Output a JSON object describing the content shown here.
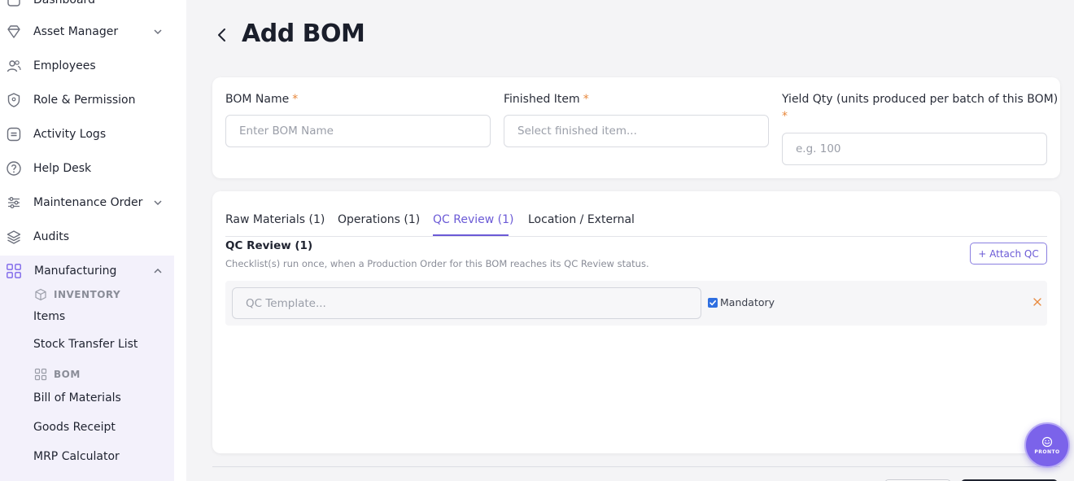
{
  "sidebar": {
    "items": [
      {
        "label": "Dashboard"
      },
      {
        "label": "Asset Manager"
      },
      {
        "label": "Employees"
      },
      {
        "label": "Role & Permission"
      },
      {
        "label": "Activity Logs"
      },
      {
        "label": "Help Desk"
      },
      {
        "label": "Maintenance Order"
      },
      {
        "label": "Audits"
      },
      {
        "label": "Manufacturing"
      }
    ],
    "manufacturing": {
      "inventory_group": "INVENTORY",
      "inventory_items": [
        {
          "label": "Items"
        },
        {
          "label": "Stock Transfer List"
        }
      ],
      "bom_group": "BOM",
      "bom_items": [
        {
          "label": "Bill of Materials"
        },
        {
          "label": "Goods Receipt"
        },
        {
          "label": "MRP Calculator"
        }
      ]
    }
  },
  "header": {
    "title": "Add BOM"
  },
  "form": {
    "bom_name": {
      "label": "BOM Name",
      "required": "*",
      "placeholder": "Enter BOM Name"
    },
    "finished_item": {
      "label": "Finished Item",
      "required": "*",
      "placeholder": "Select finished item..."
    },
    "yield_qty": {
      "label": "Yield Qty (units produced per batch of this BOM)",
      "required": "*",
      "placeholder": "e.g. 100"
    }
  },
  "tabs": [
    {
      "label": "Raw Materials (1)"
    },
    {
      "label": "Operations (1)"
    },
    {
      "label": "QC Review (1)"
    },
    {
      "label": "Location / External"
    }
  ],
  "active_tab": "QC Review (1)",
  "qc_section": {
    "title": "QC Review (1)",
    "description": "Checklist(s) run once, when a Production Order for this BOM reaches its QC Review status.",
    "attach_label": "+ Attach QC",
    "row": {
      "placeholder": "QC Template...",
      "mandatory_label": "Mandatory",
      "mandatory_checked": true
    }
  },
  "fab": {
    "label": "PRONTO"
  },
  "colors": {
    "accent": "#6b5ad6",
    "required": "#e8883c",
    "checkbox": "#2f6fe0",
    "sidebar_active_bg": "#f3f1fb"
  },
  "icons": [
    "dashboard-icon",
    "asset-manager-icon",
    "employees-icon",
    "role-permission-icon",
    "activity-logs-icon",
    "help-desk-icon",
    "maintenance-order-icon",
    "audits-icon",
    "manufacturing-icon",
    "inventory-icon",
    "bom-icon",
    "chevron-down-icon",
    "chevron-up-icon",
    "back-arrow-icon",
    "close-icon",
    "check-icon"
  ]
}
